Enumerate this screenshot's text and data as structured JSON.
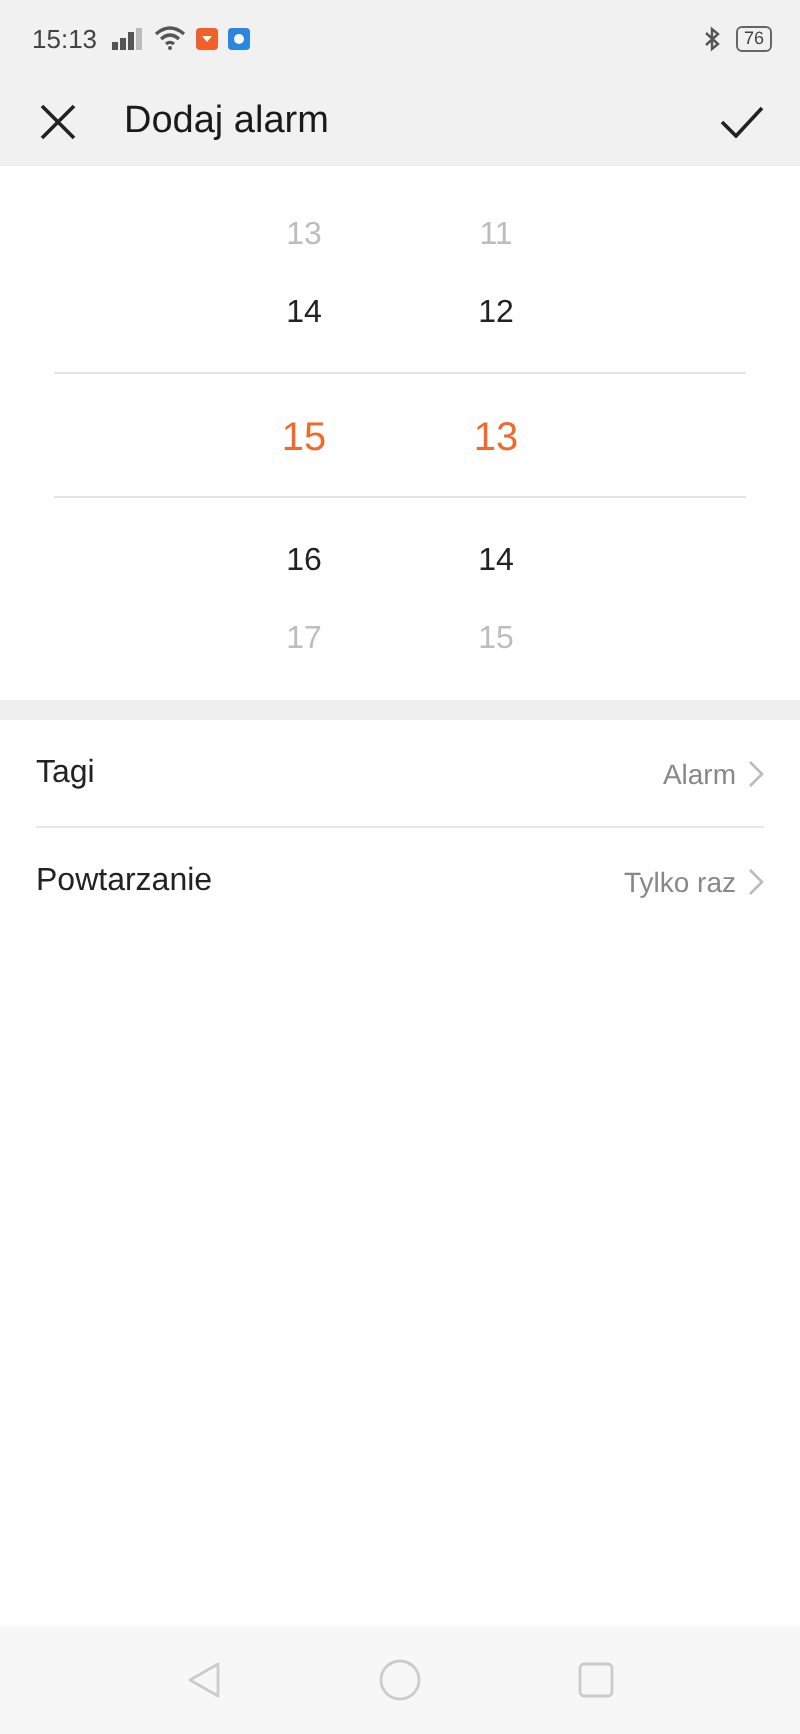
{
  "status_bar": {
    "time": "15:13",
    "battery": "76"
  },
  "header": {
    "title": "Dodaj alarm"
  },
  "picker": {
    "hours": [
      {
        "label": "13",
        "selected": false
      },
      {
        "label": "14",
        "selected": false
      },
      {
        "label": "15",
        "selected": true
      },
      {
        "label": "16",
        "selected": false
      },
      {
        "label": "17",
        "selected": false
      }
    ],
    "minutes": [
      {
        "label": "11",
        "selected": false
      },
      {
        "label": "12",
        "selected": false
      },
      {
        "label": "13",
        "selected": true
      },
      {
        "label": "14",
        "selected": false
      },
      {
        "label": "15",
        "selected": false
      }
    ]
  },
  "settings": [
    {
      "label": "Tagi",
      "value": "Alarm"
    },
    {
      "label": "Powtarzanie",
      "value": "Tylko raz"
    }
  ]
}
